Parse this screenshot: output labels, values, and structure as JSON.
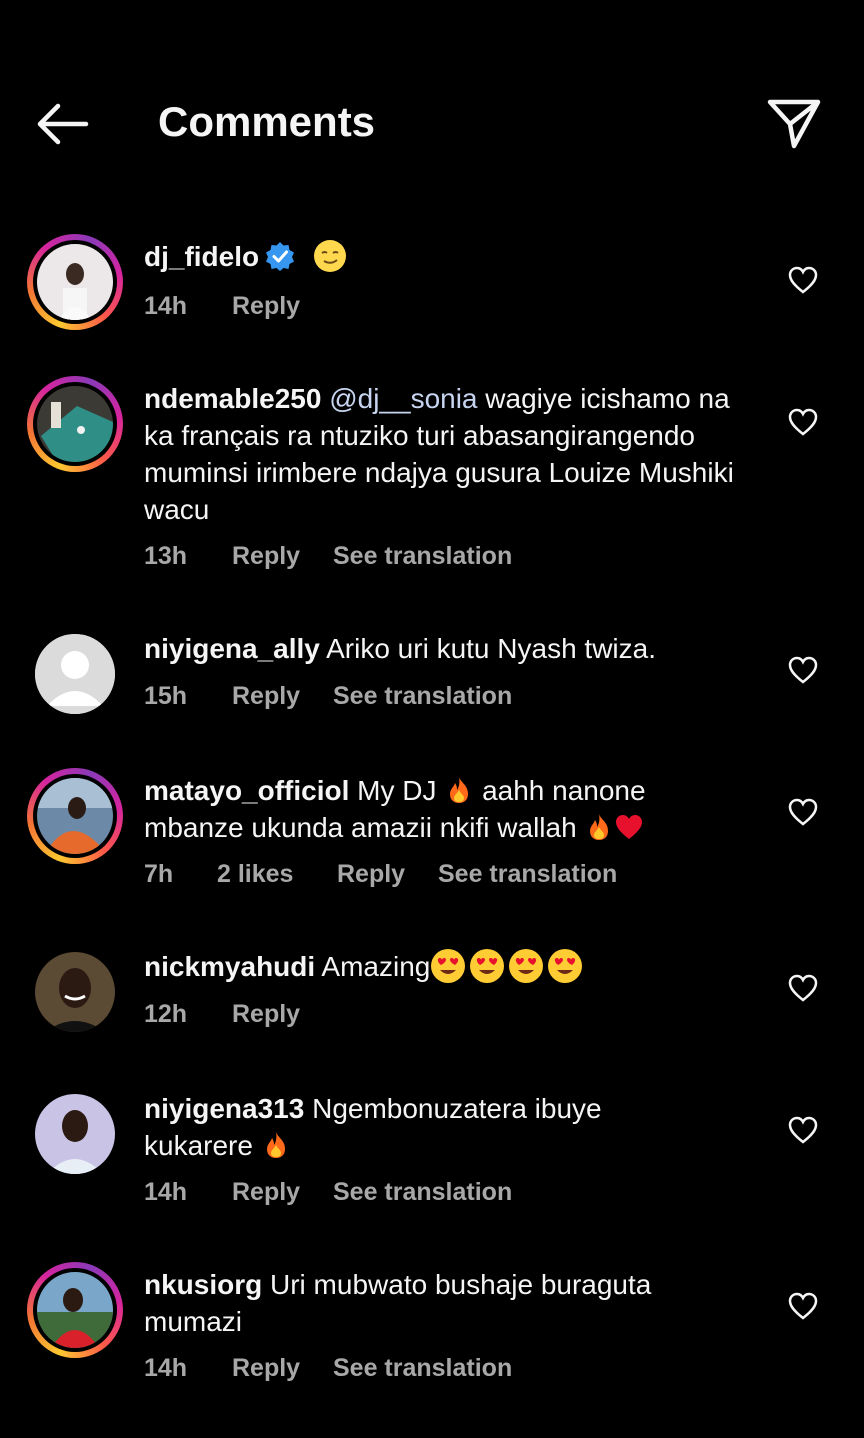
{
  "header": {
    "title": "Comments",
    "back_icon": "arrow-left-icon",
    "share_icon": "paper-plane-icon"
  },
  "colors": {
    "background": "#000000",
    "text": "#f5f5f5",
    "secondary": "#a8a8a8",
    "mention": "#c7d5f0",
    "verified": "#3797f0"
  },
  "comments": [
    {
      "username": "dj_fidelo",
      "verified": true,
      "text": "",
      "emojis": [
        "slightly-smiling-face"
      ],
      "time": "14h",
      "likes": "",
      "reply": "Reply",
      "translation": ""
    },
    {
      "username": "ndemable250",
      "mention": "@dj__sonia",
      "text": "wagiye icishamo na ka français ra ntuziko turi abasangirangendo muminsi irimbere ndajya gusura Louize Mushiki wacu",
      "time": "13h",
      "likes": "",
      "reply": "Reply",
      "translation": "See translation"
    },
    {
      "username": "niyigena_ally",
      "text": "Ariko uri kutu Nyash twiza.",
      "time": "15h",
      "likes": "",
      "reply": "Reply",
      "translation": "See translation"
    },
    {
      "username": "matayo_officiol",
      "text_line1_a": "My DJ",
      "text_line1_b": "aahh nanone",
      "text_line2": "mbanze ukunda amazii nkifi wallah",
      "time": "7h",
      "likes": "2 likes",
      "reply": "Reply",
      "translation": "See translation"
    },
    {
      "username": "nickmyahudi",
      "text": "Amazing",
      "emojis": [
        "heart-eyes",
        "heart-eyes",
        "heart-eyes",
        "heart-eyes"
      ],
      "time": "12h",
      "likes": "",
      "reply": "Reply",
      "translation": ""
    },
    {
      "username": "niyigena313",
      "text_line1": "Ngembonuzatera ibuye",
      "text_line2": "kukarere",
      "time": "14h",
      "likes": "",
      "reply": "Reply",
      "translation": "See translation"
    },
    {
      "username": "nkusiorg",
      "text_line1": "Uri mubwato bushaje buraguta",
      "text_line2": "mumazi",
      "time": "14h",
      "likes": "",
      "reply": "Reply",
      "translation": "See translation"
    }
  ]
}
